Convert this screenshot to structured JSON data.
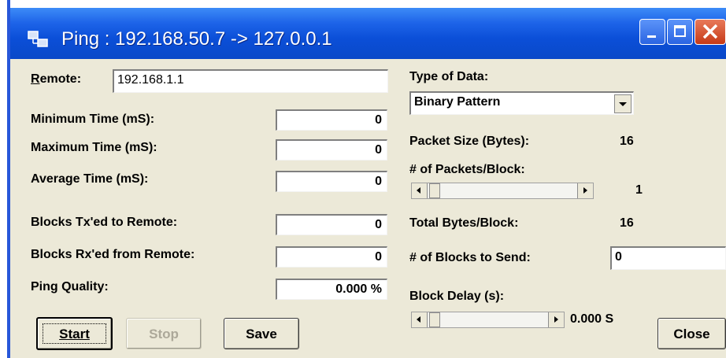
{
  "window": {
    "title": "Ping : 192.168.50.7 -> 127.0.0.1"
  },
  "remote": {
    "label": "Remote:",
    "value": "192.168.1.1"
  },
  "stats": {
    "min_time": {
      "label": "Minimum Time (mS):",
      "value": "0"
    },
    "max_time": {
      "label": "Maximum Time (mS):",
      "value": "0"
    },
    "avg_time": {
      "label": "Average Time (mS):",
      "value": "0"
    },
    "blocks_tx": {
      "label": "Blocks Tx'ed to Remote:",
      "value": "0"
    },
    "blocks_rx": {
      "label": "Blocks Rx'ed from Remote:",
      "value": "0"
    },
    "ping_quality": {
      "label": "Ping Quality:",
      "value": "0.000 %"
    }
  },
  "type_of_data": {
    "label": "Type of Data:",
    "selected": "Binary Pattern"
  },
  "packet_size": {
    "label": "Packet Size (Bytes):",
    "value": "16"
  },
  "packets_per_block": {
    "label": "# of Packets/Block:",
    "value": "1"
  },
  "total_bytes": {
    "label": "Total Bytes/Block:",
    "value": "16"
  },
  "blocks_to_send": {
    "label": "# of Blocks to Send:",
    "value": "0"
  },
  "block_delay": {
    "label": "Block Delay (s):",
    "value": "0.000 S"
  },
  "buttons": {
    "start": "Start",
    "stop": "Stop",
    "save": "Save",
    "close": "Close"
  },
  "colors": {
    "titlebar": "#0b4fd8",
    "dialog_bg": "#ece9d8",
    "close_btn": "#c63a17"
  }
}
